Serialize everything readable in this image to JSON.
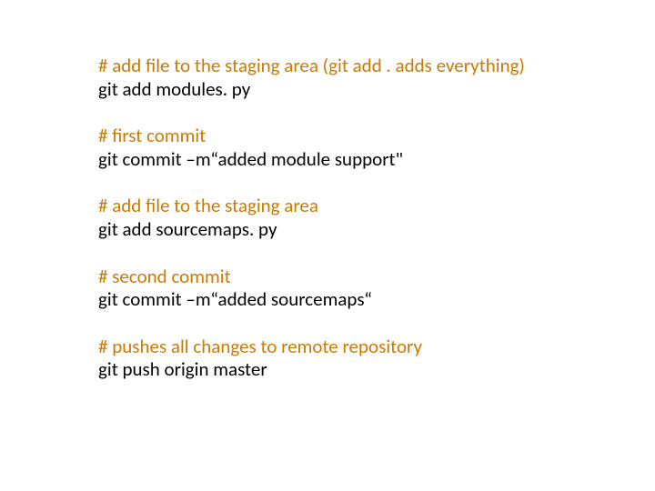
{
  "blocks": [
    {
      "comment": "# add file to the staging area (git add . adds everything)",
      "cmd": "git add modules. py"
    },
    {
      "comment": "# first commit",
      "cmd": "git commit –m“added module support\""
    },
    {
      "comment": "# add file to the staging area",
      "cmd": "git add sourcemaps. py"
    },
    {
      "comment": "# second commit",
      "cmd": "git commit –m“added sourcemaps“"
    },
    {
      "comment": "# pushes all changes to remote repository",
      "cmd": "git push origin master"
    }
  ]
}
